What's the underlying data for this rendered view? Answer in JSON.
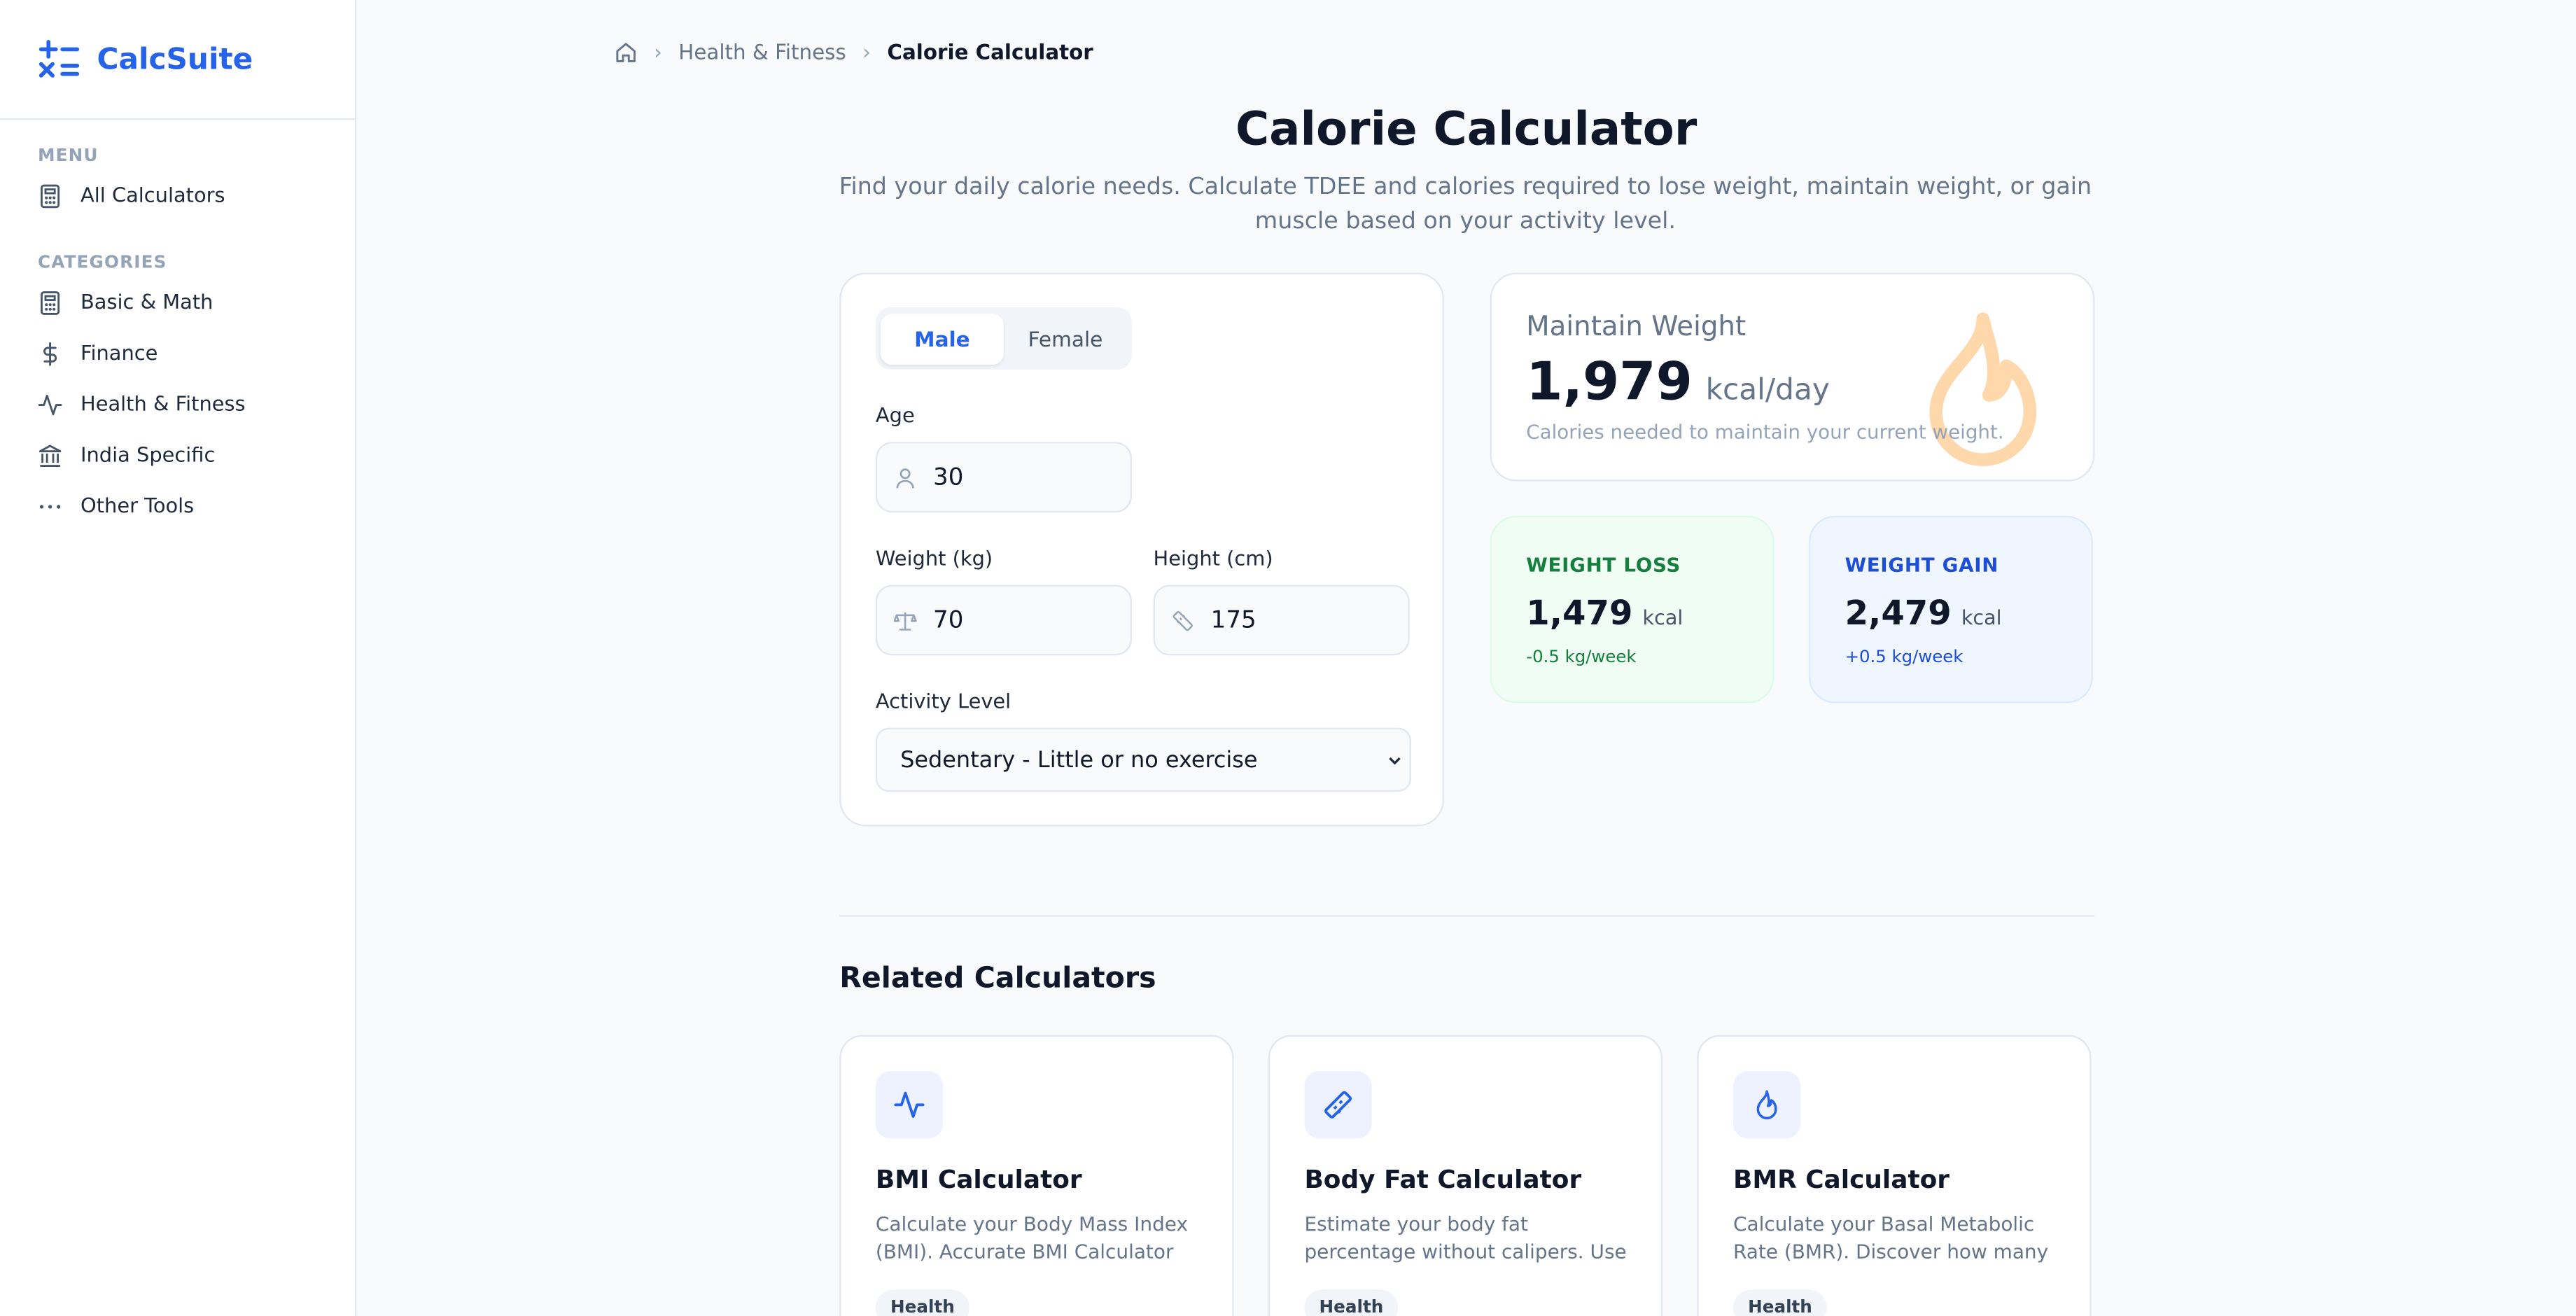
{
  "brand": {
    "name": "CalcSuite"
  },
  "sidebar": {
    "menu_heading": "MENU",
    "menu_items": [
      {
        "label": "All Calculators",
        "icon": "calculator-icon"
      }
    ],
    "categories_heading": "CATEGORIES",
    "category_items": [
      {
        "label": "Basic & Math",
        "icon": "calculator-icon"
      },
      {
        "label": "Finance",
        "icon": "dollar-icon"
      },
      {
        "label": "Health & Fitness",
        "icon": "activity-icon"
      },
      {
        "label": "India Specific",
        "icon": "bank-icon"
      },
      {
        "label": "Other Tools",
        "icon": "more-icon"
      }
    ]
  },
  "breadcrumb": {
    "home_icon": "home-icon",
    "parent": "Health & Fitness",
    "current": "Calorie Calculator"
  },
  "page": {
    "title": "Calorie Calculator",
    "subtitle": "Find your daily calorie needs. Calculate TDEE and calories required to lose weight, maintain weight, or gain muscle based on your activity level."
  },
  "form": {
    "gender": {
      "options": [
        "Male",
        "Female"
      ],
      "selected": "Male"
    },
    "age": {
      "label": "Age",
      "value": "30"
    },
    "weight": {
      "label": "Weight (kg)",
      "value": "70"
    },
    "height": {
      "label": "Height (cm)",
      "value": "175"
    },
    "activity": {
      "label": "Activity Level",
      "value": "Sedentary - Little or no exercise"
    }
  },
  "results": {
    "maintain": {
      "title": "Maintain Weight",
      "value": "1,979",
      "unit": "kcal/day",
      "note": "Calories needed to maintain your current weight."
    },
    "loss": {
      "title": "WEIGHT LOSS",
      "value": "1,479",
      "unit": "kcal",
      "rate": "-0.5 kg/week"
    },
    "gain": {
      "title": "WEIGHT GAIN",
      "value": "2,479",
      "unit": "kcal",
      "rate": "+0.5 kg/week"
    }
  },
  "related": {
    "heading": "Related Calculators",
    "items": [
      {
        "title": "BMI Calculator",
        "desc": "Calculate your Body Mass Index (BMI). Accurate BMI Calculator for…",
        "tag": "Health",
        "icon": "activity-icon"
      },
      {
        "title": "Body Fat Calculator",
        "desc": "Estimate your body fat percentage without calipers. Use our US Navy…",
        "tag": "Health",
        "icon": "ruler-icon"
      },
      {
        "title": "BMR Calculator",
        "desc": "Calculate your Basal Metabolic Rate (BMR). Discover how many calorie…",
        "tag": "Health",
        "icon": "flame-icon"
      }
    ]
  },
  "colors": {
    "accent": "#2563eb",
    "loss_bg": "#f0fdf4",
    "loss_text": "#15803d",
    "gain_bg": "#eff6ff",
    "gain_text": "#1d4ed8",
    "flame": "#fed7aa"
  }
}
